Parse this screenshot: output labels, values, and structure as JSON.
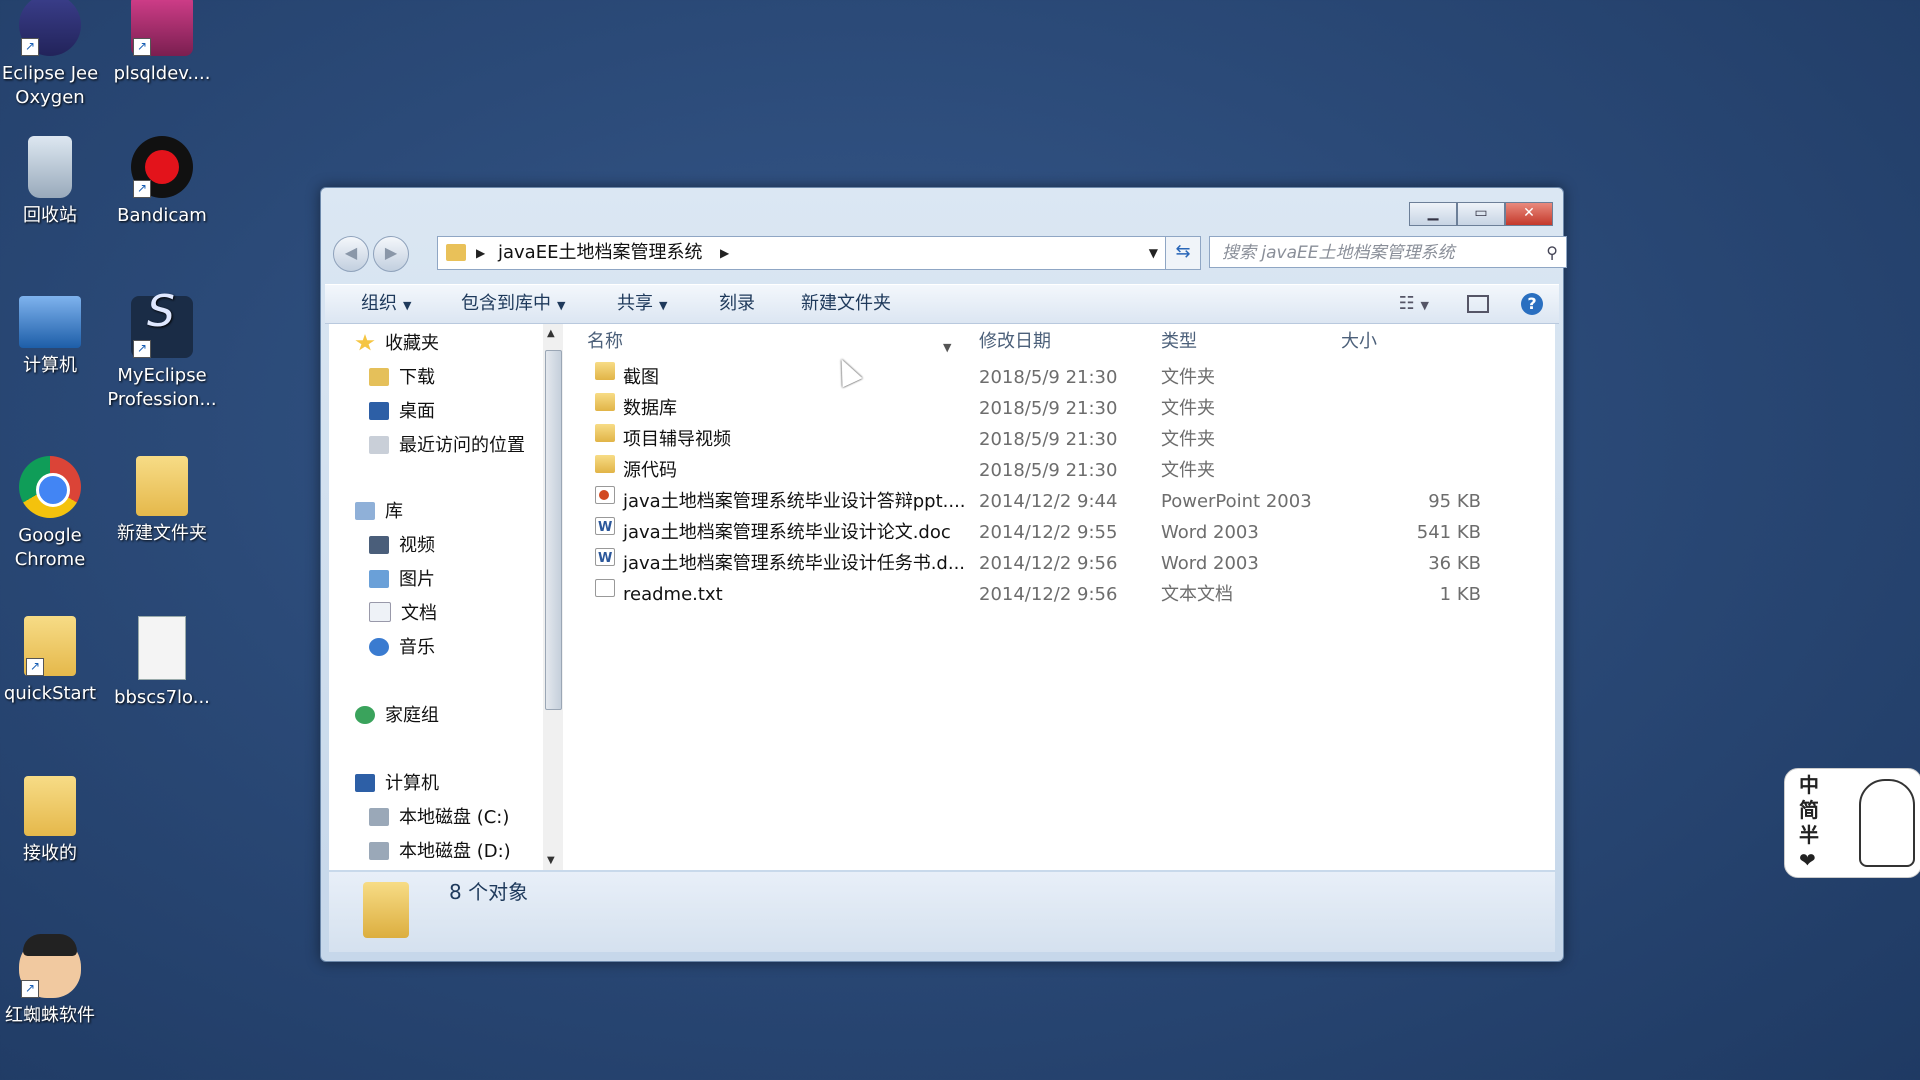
{
  "desktop": {
    "icons": [
      {
        "label": "Eclipse Jee Oxygen",
        "icon": "eclipse-icon"
      },
      {
        "label": "plsqldev....",
        "icon": "plsql-icon"
      },
      {
        "label": "回收站",
        "icon": "recycle-bin-icon"
      },
      {
        "label": "Bandicam",
        "icon": "bandicam-icon"
      },
      {
        "label": "计算机",
        "icon": "computer-icon"
      },
      {
        "label": "MyEclipse Profession...",
        "icon": "myeclipse-icon"
      },
      {
        "label": "Google Chrome",
        "icon": "chrome-icon"
      },
      {
        "label": "新建文件夹",
        "icon": "folder-icon"
      },
      {
        "label": "quickStart",
        "icon": "folder-icon"
      },
      {
        "label": "bbscs7lo...",
        "icon": "document-icon"
      },
      {
        "label": "接收的",
        "icon": "folder-icon"
      },
      {
        "label": "红蜘蛛软件",
        "icon": "avatar-icon"
      }
    ]
  },
  "window": {
    "address": {
      "crumb": "javaEE土地档案管理系统"
    },
    "search": {
      "placeholder": "搜索 javaEE土地档案管理系统"
    },
    "toolbar": {
      "organize": "组织",
      "include_in_library": "包含到库中",
      "share": "共享",
      "burn": "刻录",
      "new_folder": "新建文件夹"
    },
    "nav": {
      "favorites": "收藏夹",
      "downloads": "下载",
      "desktop": "桌面",
      "recent": "最近访问的位置",
      "libraries": "库",
      "videos": "视频",
      "pictures": "图片",
      "documents": "文档",
      "music": "音乐",
      "homegroup": "家庭组",
      "computer": "计算机",
      "drive_c": "本地磁盘 (C:)",
      "drive_d": "本地磁盘 (D:)"
    },
    "columns": {
      "name": "名称",
      "modified": "修改日期",
      "type": "类型",
      "size": "大小"
    },
    "files": [
      {
        "name": "截图",
        "modified": "2018/5/9 21:30",
        "type": "文件夹",
        "size": "",
        "kind": "folder"
      },
      {
        "name": "数据库",
        "modified": "2018/5/9 21:30",
        "type": "文件夹",
        "size": "",
        "kind": "folder"
      },
      {
        "name": "项目辅导视频",
        "modified": "2018/5/9 21:30",
        "type": "文件夹",
        "size": "",
        "kind": "folder"
      },
      {
        "name": "源代码",
        "modified": "2018/5/9 21:30",
        "type": "文件夹",
        "size": "",
        "kind": "folder"
      },
      {
        "name": "java土地档案管理系统毕业设计答辩ppt....",
        "modified": "2014/12/2 9:44",
        "type": "PowerPoint 2003",
        "size": "95 KB",
        "kind": "ppt"
      },
      {
        "name": "java土地档案管理系统毕业设计论文.doc",
        "modified": "2014/12/2 9:55",
        "type": "Word 2003",
        "size": "541 KB",
        "kind": "doc"
      },
      {
        "name": "java土地档案管理系统毕业设计任务书.d...",
        "modified": "2014/12/2 9:56",
        "type": "Word 2003",
        "size": "36 KB",
        "kind": "doc"
      },
      {
        "name": "readme.txt",
        "modified": "2014/12/2 9:56",
        "type": "文本文档",
        "size": "1 KB",
        "kind": "txt"
      }
    ],
    "status": {
      "count": "8 个对象"
    }
  },
  "widget": {
    "chars": [
      "中",
      "简",
      "半",
      "❤"
    ]
  }
}
